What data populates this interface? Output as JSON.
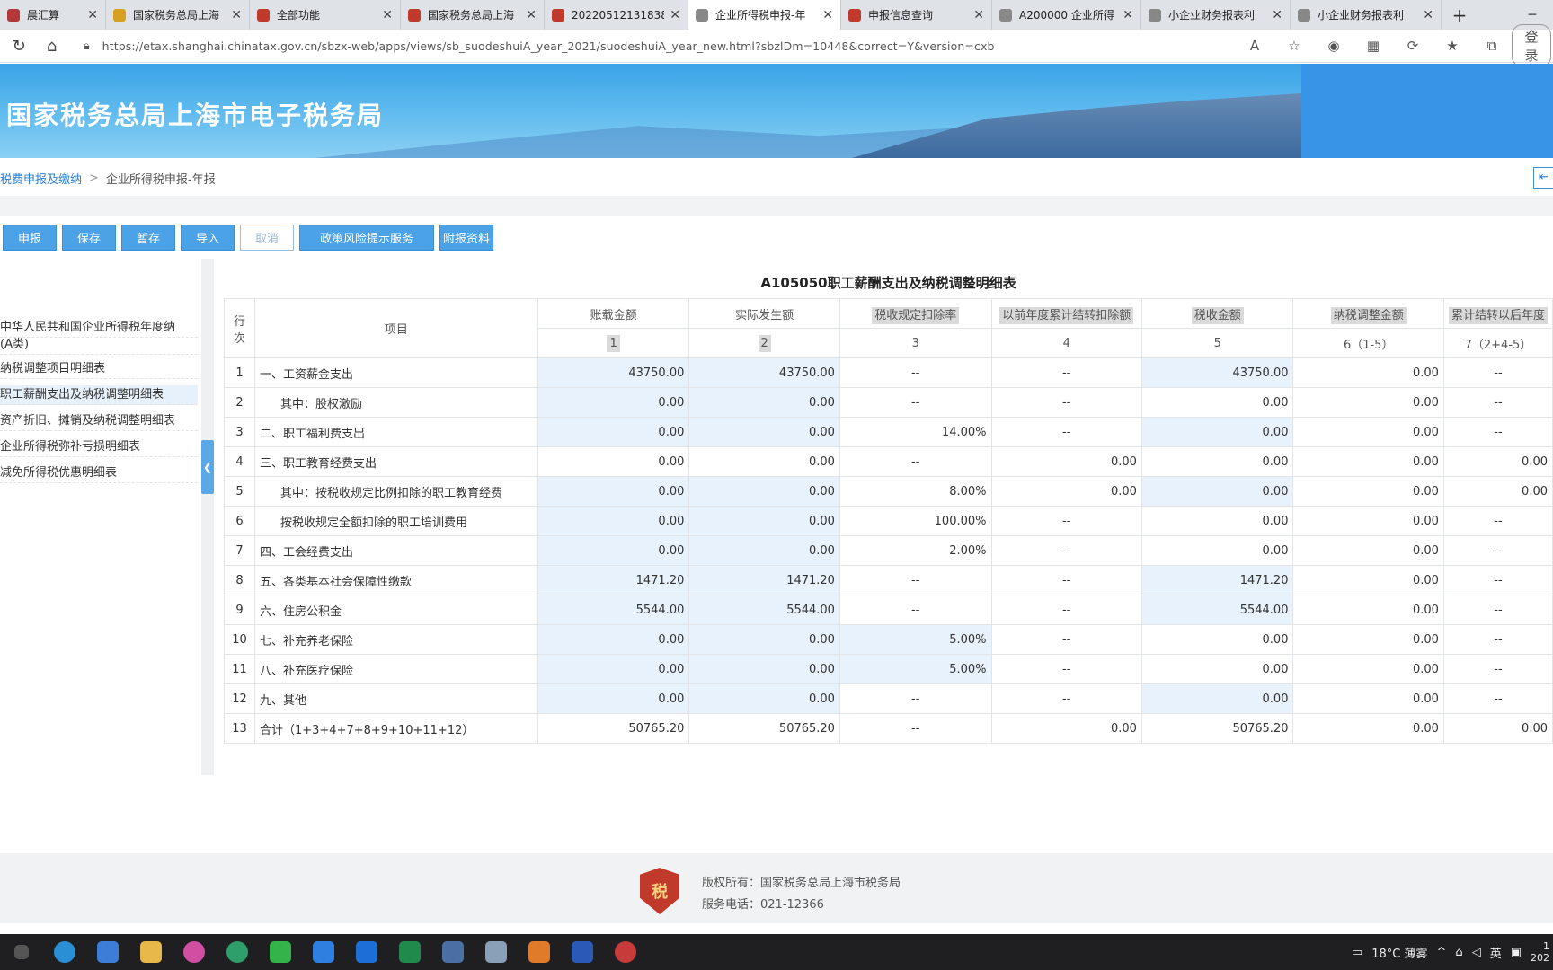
{
  "browser": {
    "tabs": [
      {
        "label": "晨汇算",
        "color": "#b33939"
      },
      {
        "label": "国家税务总局上海",
        "color": "#d6a11e"
      },
      {
        "label": "全部功能",
        "color": "#c0392b"
      },
      {
        "label": "国家税务总局上海",
        "color": "#c0392b"
      },
      {
        "label": "20220512131838",
        "color": "#c0392b"
      },
      {
        "label": "企业所得税申报-年",
        "color": "#888888",
        "active": true
      },
      {
        "label": "申报信息查询",
        "color": "#c0392b"
      },
      {
        "label": "A200000 企业所得",
        "color": "#888888"
      },
      {
        "label": "小企业财务报表利",
        "color": "#888888"
      },
      {
        "label": "小企业财务报表利",
        "color": "#888888"
      }
    ],
    "url": "https://etax.shanghai.chinatax.gov.cn/sbzx-web/apps/views/sb_suodeshuiA_year_2021/suodeshuiA_year_new.html?sbzlDm=10448&correct=Y&version=cxb",
    "login_label": "登录"
  },
  "banner": {
    "title": "国家税务总局上海市电子税务局"
  },
  "breadcrumb": {
    "root": "税费申报及缴纳",
    "current": "企业所得税申报-年报"
  },
  "toolbar": {
    "buttons": [
      "申报",
      "保存",
      "暂存",
      "导入",
      "取消",
      "政策风险提示服务",
      "附报资料"
    ]
  },
  "sidenav": {
    "items": [
      "中华人民共和国企业所得税年度纳",
      "(A类)",
      "纳税调整项目明细表",
      "职工薪酬支出及纳税调整明细表",
      "资产折旧、摊销及纳税调整明细表",
      "企业所得税弥补亏损明细表",
      "减免所得税优惠明细表"
    ]
  },
  "table": {
    "title": "A105050职工薪酬支出及纳税调整明细表",
    "headers": {
      "rownum": "行次",
      "item": "项目",
      "cols": [
        "账载金额",
        "实际发生额",
        "税收规定扣除率",
        "以前年度累计结转扣除额",
        "税收金额",
        "纳税调整金额",
        "累计结转以后年度"
      ],
      "col_nums": [
        "1",
        "2",
        "3",
        "4",
        "5",
        "6（1-5）",
        "7（2+4-5）"
      ]
    },
    "rows": [
      {
        "n": "1",
        "item": "一、工资薪金支出",
        "c": [
          "43750.00",
          "43750.00",
          "--",
          "--",
          "43750.00",
          "0.00",
          "--"
        ]
      },
      {
        "n": "2",
        "item": "其中：股权激励",
        "c": [
          "0.00",
          "0.00",
          "--",
          "--",
          "0.00",
          "0.00",
          "--"
        ]
      },
      {
        "n": "3",
        "item": "二、职工福利费支出",
        "c": [
          "0.00",
          "0.00",
          "14.00%",
          "--",
          "0.00",
          "0.00",
          "--"
        ]
      },
      {
        "n": "4",
        "item": "三、职工教育经费支出",
        "c": [
          "0.00",
          "0.00",
          "--",
          "0.00",
          "0.00",
          "0.00",
          "0.00"
        ]
      },
      {
        "n": "5",
        "item": "其中：按税收规定比例扣除的职工教育经费",
        "c": [
          "0.00",
          "0.00",
          "8.00%",
          "0.00",
          "0.00",
          "0.00",
          "0.00"
        ]
      },
      {
        "n": "6",
        "item": "按税收规定全额扣除的职工培训费用",
        "c": [
          "0.00",
          "0.00",
          "100.00%",
          "--",
          "0.00",
          "0.00",
          "--"
        ]
      },
      {
        "n": "7",
        "item": "四、工会经费支出",
        "c": [
          "0.00",
          "0.00",
          "2.00%",
          "--",
          "0.00",
          "0.00",
          "--"
        ]
      },
      {
        "n": "8",
        "item": "五、各类基本社会保障性缴款",
        "c": [
          "1471.20",
          "1471.20",
          "--",
          "--",
          "1471.20",
          "0.00",
          "--"
        ]
      },
      {
        "n": "9",
        "item": "六、住房公积金",
        "c": [
          "5544.00",
          "5544.00",
          "--",
          "--",
          "5544.00",
          "0.00",
          "--"
        ]
      },
      {
        "n": "10",
        "item": "七、补充养老保险",
        "c": [
          "0.00",
          "0.00",
          "5.00%",
          "--",
          "0.00",
          "0.00",
          "--"
        ]
      },
      {
        "n": "11",
        "item": "八、补充医疗保险",
        "c": [
          "0.00",
          "0.00",
          "5.00%",
          "--",
          "0.00",
          "0.00",
          "--"
        ]
      },
      {
        "n": "12",
        "item": "九、其他",
        "c": [
          "0.00",
          "0.00",
          "--",
          "--",
          "0.00",
          "0.00",
          "--"
        ]
      },
      {
        "n": "13",
        "item": "合计（1+3+4+7+8+9+10+11+12）",
        "c": [
          "50765.20",
          "50765.20",
          "--",
          "0.00",
          "50765.20",
          "0.00",
          "0.00"
        ]
      }
    ]
  },
  "footer": {
    "copyright": "版权所有：国家税务总局上海市税务局",
    "phone": "服务电话：021-12366"
  },
  "taskbar": {
    "weather": "18°C 薄雾",
    "ime": "英",
    "time": "1",
    "date": "202"
  }
}
